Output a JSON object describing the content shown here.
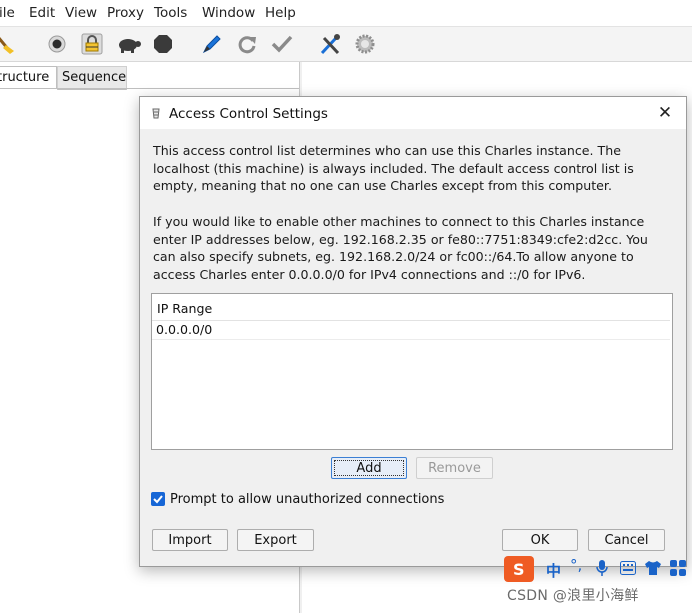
{
  "menubar": {
    "items": [
      "ile",
      "Edit",
      "View",
      "Proxy",
      "Tools",
      "Window",
      "Help"
    ]
  },
  "toolbar": {
    "icons": [
      "broom-icon",
      "record-icon",
      "ssl-lock-icon",
      "turtle-throttle-icon",
      "stop-icon",
      "pen-compose-icon",
      "repeat-icon",
      "validate-check-icon",
      "tools-icon",
      "settings-gear-icon"
    ]
  },
  "left_panel": {
    "tabs": [
      "tructure",
      "Sequence"
    ]
  },
  "dialog": {
    "title": "Access Control Settings",
    "paragraph1": "This access control list determines who can use this Charles instance. The localhost (this machine) is always included. The default access control list is empty, meaning that no one can use Charles except from this computer.",
    "paragraph2": "If you would like to enable other machines to connect to this Charles instance enter IP addresses below, eg. 192.168.2.35 or fe80::7751:8349:cfe2:d2cc. You can also specify subnets, eg. 192.168.2.0/24 or fc00::/64.To allow anyone to access Charles enter 0.0.0.0/0 for IPv4 connections and ::/0 for IPv6.",
    "table": {
      "header": "IP Range",
      "rows": [
        "0.0.0.0/0"
      ]
    },
    "add_label": "Add",
    "remove_label": "Remove",
    "checkbox_label": "Prompt to allow unauthorized connections",
    "checkbox_checked": true,
    "import_label": "Import",
    "export_label": "Export",
    "ok_label": "OK",
    "cancel_label": "Cancel"
  },
  "watermark": {
    "ime_text": "中",
    "text": "CSDN @浪里小海鲜"
  },
  "colors": {
    "accent": "#1666d6",
    "ime_orange": "#ef5b23"
  }
}
